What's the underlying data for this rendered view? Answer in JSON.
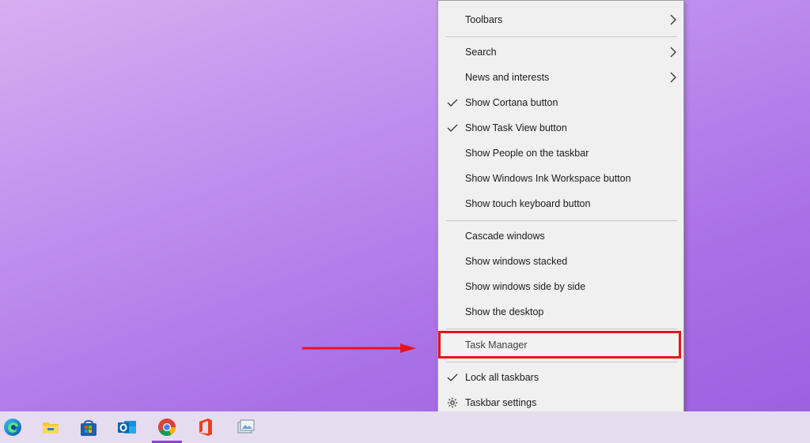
{
  "context_menu": {
    "items": [
      {
        "label": "Toolbars",
        "submenu": true,
        "checked": false
      },
      {
        "label": "Search",
        "submenu": true,
        "checked": false
      },
      {
        "label": "News and interests",
        "submenu": true,
        "checked": false
      },
      {
        "label": "Show Cortana button",
        "submenu": false,
        "checked": true
      },
      {
        "label": "Show Task View button",
        "submenu": false,
        "checked": true
      },
      {
        "label": "Show People on the taskbar",
        "submenu": false,
        "checked": false
      },
      {
        "label": "Show Windows Ink Workspace button",
        "submenu": false,
        "checked": false
      },
      {
        "label": "Show touch keyboard button",
        "submenu": false,
        "checked": false
      },
      {
        "label": "Cascade windows",
        "submenu": false,
        "checked": false
      },
      {
        "label": "Show windows stacked",
        "submenu": false,
        "checked": false
      },
      {
        "label": "Show windows side by side",
        "submenu": false,
        "checked": false
      },
      {
        "label": "Show the desktop",
        "submenu": false,
        "checked": false
      },
      {
        "label": "Task Manager",
        "submenu": false,
        "checked": false,
        "highlighted": true
      },
      {
        "label": "Lock all taskbars",
        "submenu": false,
        "checked": true
      },
      {
        "label": "Taskbar settings",
        "submenu": false,
        "checked": false,
        "icon": "gear-icon"
      }
    ]
  },
  "annotation": {
    "arrow_color": "#e8141c",
    "highlight_color": "#e8141c"
  },
  "taskbar": {
    "apps": [
      {
        "icon": "edge-icon"
      },
      {
        "icon": "file-explorer-icon"
      },
      {
        "icon": "microsoft-store-icon"
      },
      {
        "icon": "outlook-icon"
      },
      {
        "icon": "chrome-icon",
        "active": true
      },
      {
        "icon": "office-icon"
      },
      {
        "icon": "photos-app-icon"
      }
    ]
  }
}
